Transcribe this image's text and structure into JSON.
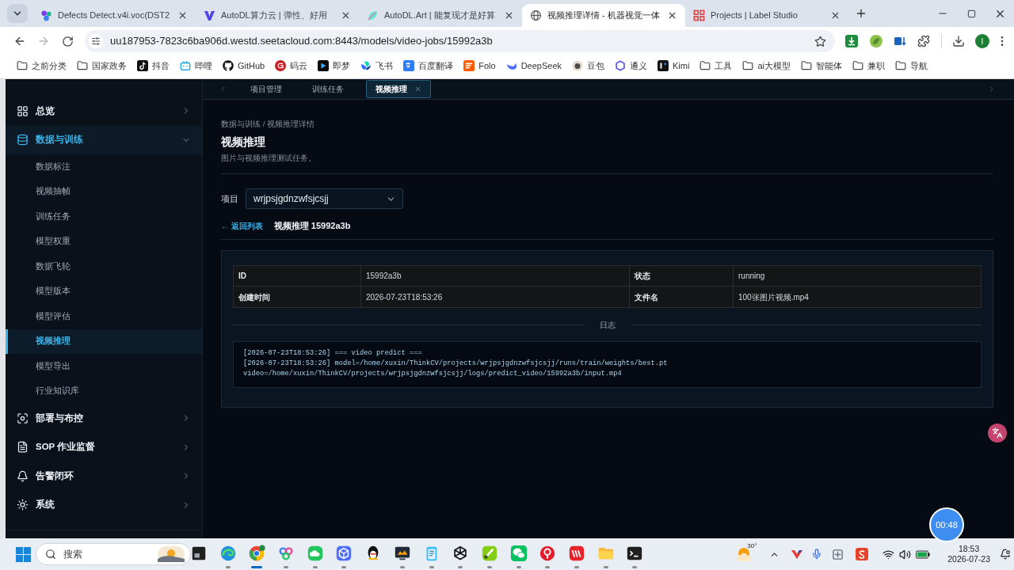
{
  "browser": {
    "tabs": [
      {
        "title": "Defects Detect.v4i.voc(DST2",
        "selected": false
      },
      {
        "title": "AutoDL算力云 | 弹性、好用",
        "selected": false
      },
      {
        "title": "AutoDL.Art | 能复现才是好算",
        "selected": false
      },
      {
        "title": "视频推理详情 - 机器视觉一体",
        "selected": true
      },
      {
        "title": "Projects | Label Studio",
        "selected": false
      }
    ],
    "url": "uu187953-7823c6ba906d.westd.seetacloud.com:8443/models/video-jobs/15992a3b",
    "profile_initial": "I",
    "bookmarks": [
      {
        "label": "之前分类",
        "kind": "folder"
      },
      {
        "label": "国家政务",
        "kind": "folder"
      },
      {
        "label": "抖音",
        "kind": "site"
      },
      {
        "label": "哔哩",
        "kind": "site"
      },
      {
        "label": "GitHub",
        "kind": "site"
      },
      {
        "label": "码云",
        "kind": "site"
      },
      {
        "label": "即梦",
        "kind": "site"
      },
      {
        "label": "飞书",
        "kind": "site"
      },
      {
        "label": "百度翻译",
        "kind": "site"
      },
      {
        "label": "Folo",
        "kind": "site"
      },
      {
        "label": "DeepSeek",
        "kind": "site"
      },
      {
        "label": "豆包",
        "kind": "site"
      },
      {
        "label": "通义",
        "kind": "site"
      },
      {
        "label": "Kimi",
        "kind": "site"
      },
      {
        "label": "工具",
        "kind": "folder"
      },
      {
        "label": "ai大模型",
        "kind": "folder"
      },
      {
        "label": "智能体",
        "kind": "folder"
      },
      {
        "label": "兼职",
        "kind": "folder"
      },
      {
        "label": "导航",
        "kind": "folder"
      }
    ]
  },
  "sidebar": {
    "items": [
      {
        "label": "总览",
        "selected": false,
        "expanded": false
      },
      {
        "label": "数据与训练",
        "selected": true,
        "expanded": true,
        "children": [
          {
            "label": "数据标注",
            "selected": false
          },
          {
            "label": "视频抽帧",
            "selected": false
          },
          {
            "label": "训练任务",
            "selected": false
          },
          {
            "label": "模型权重",
            "selected": false
          },
          {
            "label": "数据飞轮",
            "selected": false
          },
          {
            "label": "模型版本",
            "selected": false
          },
          {
            "label": "模型评估",
            "selected": false
          },
          {
            "label": "视频推理",
            "selected": true
          },
          {
            "label": "模型导出",
            "selected": false
          },
          {
            "label": "行业知识库",
            "selected": false
          }
        ]
      },
      {
        "label": "部署与布控",
        "selected": false,
        "expanded": false
      },
      {
        "label": "SOP 作业监督",
        "selected": false,
        "expanded": false
      },
      {
        "label": "告警闭环",
        "selected": false,
        "expanded": false
      },
      {
        "label": "系统",
        "selected": false,
        "expanded": false
      }
    ]
  },
  "page": {
    "tabs": [
      {
        "label": "项目管理",
        "selected": false
      },
      {
        "label": "训练任务",
        "selected": false
      },
      {
        "label": "视频推理",
        "selected": true
      }
    ],
    "breadcrumb": "数据与训练 / 视频推理详情",
    "title": "视频推理",
    "subtitle": "图片与视频推理测试任务。",
    "project": {
      "label": "项目",
      "value": "wrjpsjgdnzwfsjcsjj"
    },
    "back_link": "← 返回列表",
    "job_title": "视频推理 15992a3b",
    "details": {
      "rows": [
        [
          "ID",
          "15992a3b",
          "状态",
          "running"
        ],
        [
          "创建时间",
          "2026-07-23T18:53:26",
          "文件名",
          "100张图片视频.mp4"
        ]
      ]
    },
    "log": {
      "heading": "日志",
      "lines": [
        "[2026-07-23T18:53:26] === video predict ===",
        "[2026-07-23T18:53:26] model=/home/xuxin/ThinkCV/projects/wrjpsjgdnzwfsjcsjj/runs/train/weights/best.pt",
        "video=/home/xuxin/ThinkCV/projects/wrjpsjgdnzwfsjcsjj/logs/predict_video/15992a3b/input.mp4"
      ]
    }
  },
  "recorder": {
    "time": "00:48"
  },
  "taskbar": {
    "search": {
      "placeholder": "搜索"
    },
    "apps": [
      {
        "running": false,
        "selected": false
      },
      {
        "running": true,
        "selected": false
      },
      {
        "running": true,
        "selected": true
      },
      {
        "running": true,
        "selected": false
      },
      {
        "running": true,
        "selected": false
      },
      {
        "running": true,
        "selected": false
      },
      {
        "running": false,
        "selected": false
      },
      {
        "running": true,
        "selected": false
      },
      {
        "running": true,
        "selected": false
      },
      {
        "running": true,
        "selected": false
      },
      {
        "running": true,
        "selected": false
      },
      {
        "running": true,
        "selected": false
      },
      {
        "running": true,
        "selected": false
      },
      {
        "running": true,
        "selected": false
      },
      {
        "running": true,
        "selected": false
      },
      {
        "running": true,
        "selected": false
      }
    ],
    "weather": "30°",
    "time": "18:53",
    "date": "2026-07-23"
  }
}
